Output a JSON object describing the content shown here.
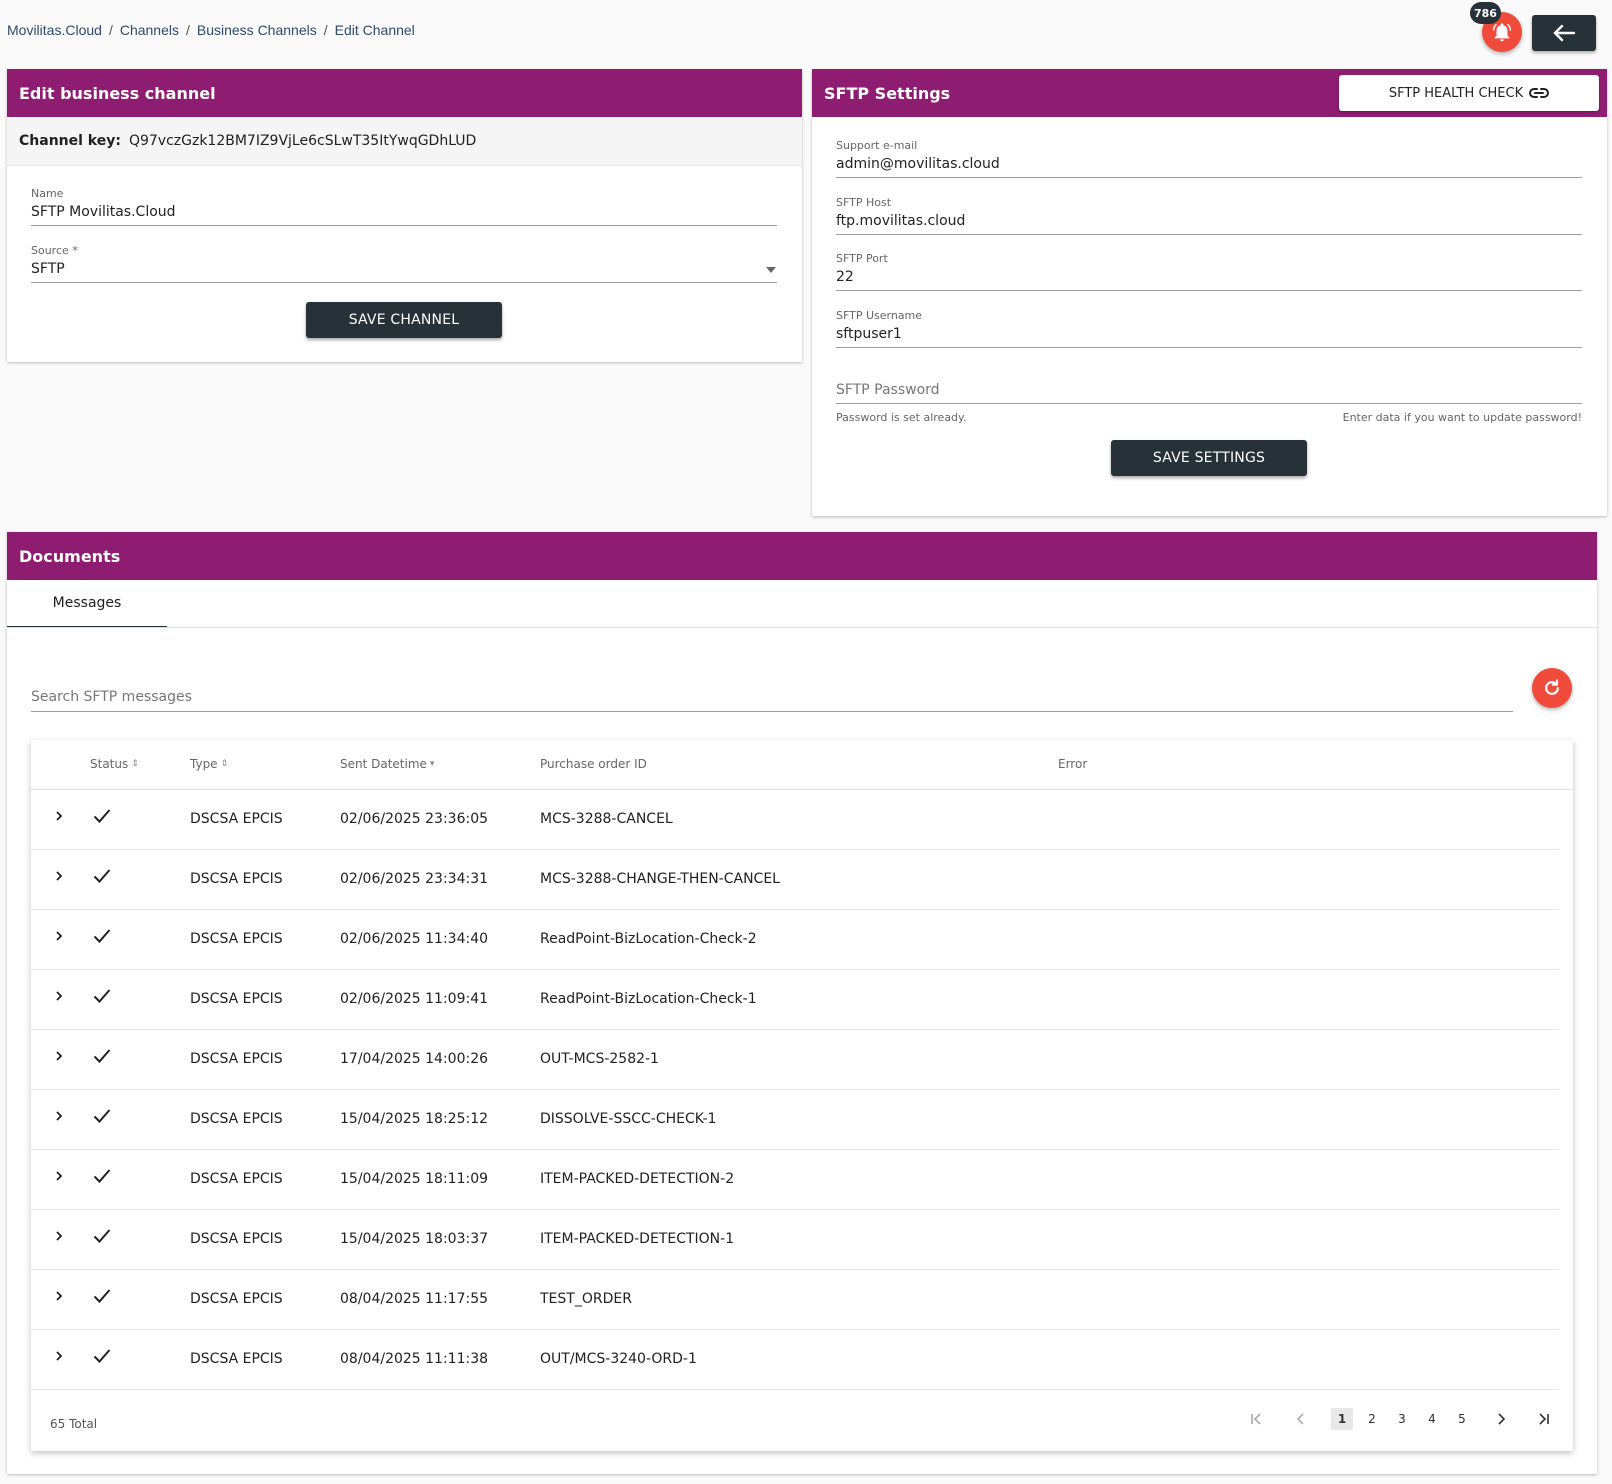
{
  "breadcrumb": [
    "Movilitas.Cloud",
    "Channels",
    "Business Channels",
    "Edit Channel"
  ],
  "notifications": {
    "count": "786",
    "icon": "bell-icon"
  },
  "back_icon": "arrow-left-icon",
  "edit_channel": {
    "title": "Edit business channel",
    "channel_key_label": "Channel key:",
    "channel_key_value": "Q97vczGzk12BM7IZ9VjLe6cSLwT35ItYwqGDhLUD",
    "name_label": "Name",
    "name_value": "SFTP Movilitas.Cloud",
    "source_label": "Source *",
    "source_value": "SFTP",
    "save_label": "SAVE CHANNEL"
  },
  "sftp": {
    "title": "SFTP Settings",
    "health_check_label": "SFTP HEALTH CHECK",
    "support_email_label": "Support e-mail",
    "support_email_value": "admin@movilitas.cloud",
    "host_label": "SFTP Host",
    "host_value": "ftp.movilitas.cloud",
    "port_label": "SFTP Port",
    "port_value": "22",
    "username_label": "SFTP Username",
    "username_value": "sftpuser1",
    "password_placeholder": "SFTP Password",
    "password_hint_left": "Password is set already.",
    "password_hint_right": "Enter data if you want to update password!",
    "save_label": "SAVE SETTINGS"
  },
  "documents": {
    "title": "Documents",
    "tab_label": "Messages",
    "search_placeholder": "Search SFTP messages",
    "columns": {
      "status": "Status",
      "type": "Type",
      "sent": "Sent Datetime",
      "po": "Purchase order ID",
      "error": "Error"
    },
    "rows": [
      {
        "type": "DSCSA EPCIS",
        "sent": "02/06/2025 23:36:05",
        "po": "MCS-3288-CANCEL"
      },
      {
        "type": "DSCSA EPCIS",
        "sent": "02/06/2025 23:34:31",
        "po": "MCS-3288-CHANGE-THEN-CANCEL"
      },
      {
        "type": "DSCSA EPCIS",
        "sent": "02/06/2025 11:34:40",
        "po": "ReadPoint-BizLocation-Check-2"
      },
      {
        "type": "DSCSA EPCIS",
        "sent": "02/06/2025 11:09:41",
        "po": "ReadPoint-BizLocation-Check-1"
      },
      {
        "type": "DSCSA EPCIS",
        "sent": "17/04/2025 14:00:26",
        "po": "OUT-MCS-2582-1"
      },
      {
        "type": "DSCSA EPCIS",
        "sent": "15/04/2025 18:25:12",
        "po": "DISSOLVE-SSCC-CHECK-1"
      },
      {
        "type": "DSCSA EPCIS",
        "sent": "15/04/2025 18:11:09",
        "po": "ITEM-PACKED-DETECTION-2"
      },
      {
        "type": "DSCSA EPCIS",
        "sent": "15/04/2025 18:03:37",
        "po": "ITEM-PACKED-DETECTION-1"
      },
      {
        "type": "DSCSA EPCIS",
        "sent": "08/04/2025 11:17:55",
        "po": "TEST_ORDER"
      },
      {
        "type": "DSCSA EPCIS",
        "sent": "08/04/2025 11:11:38",
        "po": "OUT/MCS-3240-ORD-1"
      }
    ],
    "total_label": "65 Total",
    "pages": [
      "1",
      "2",
      "3",
      "4",
      "5"
    ],
    "current_page": "1"
  },
  "colors": {
    "header": "#8e1d72",
    "dark_button": "#263238",
    "accent_red": "#f04a3a"
  }
}
